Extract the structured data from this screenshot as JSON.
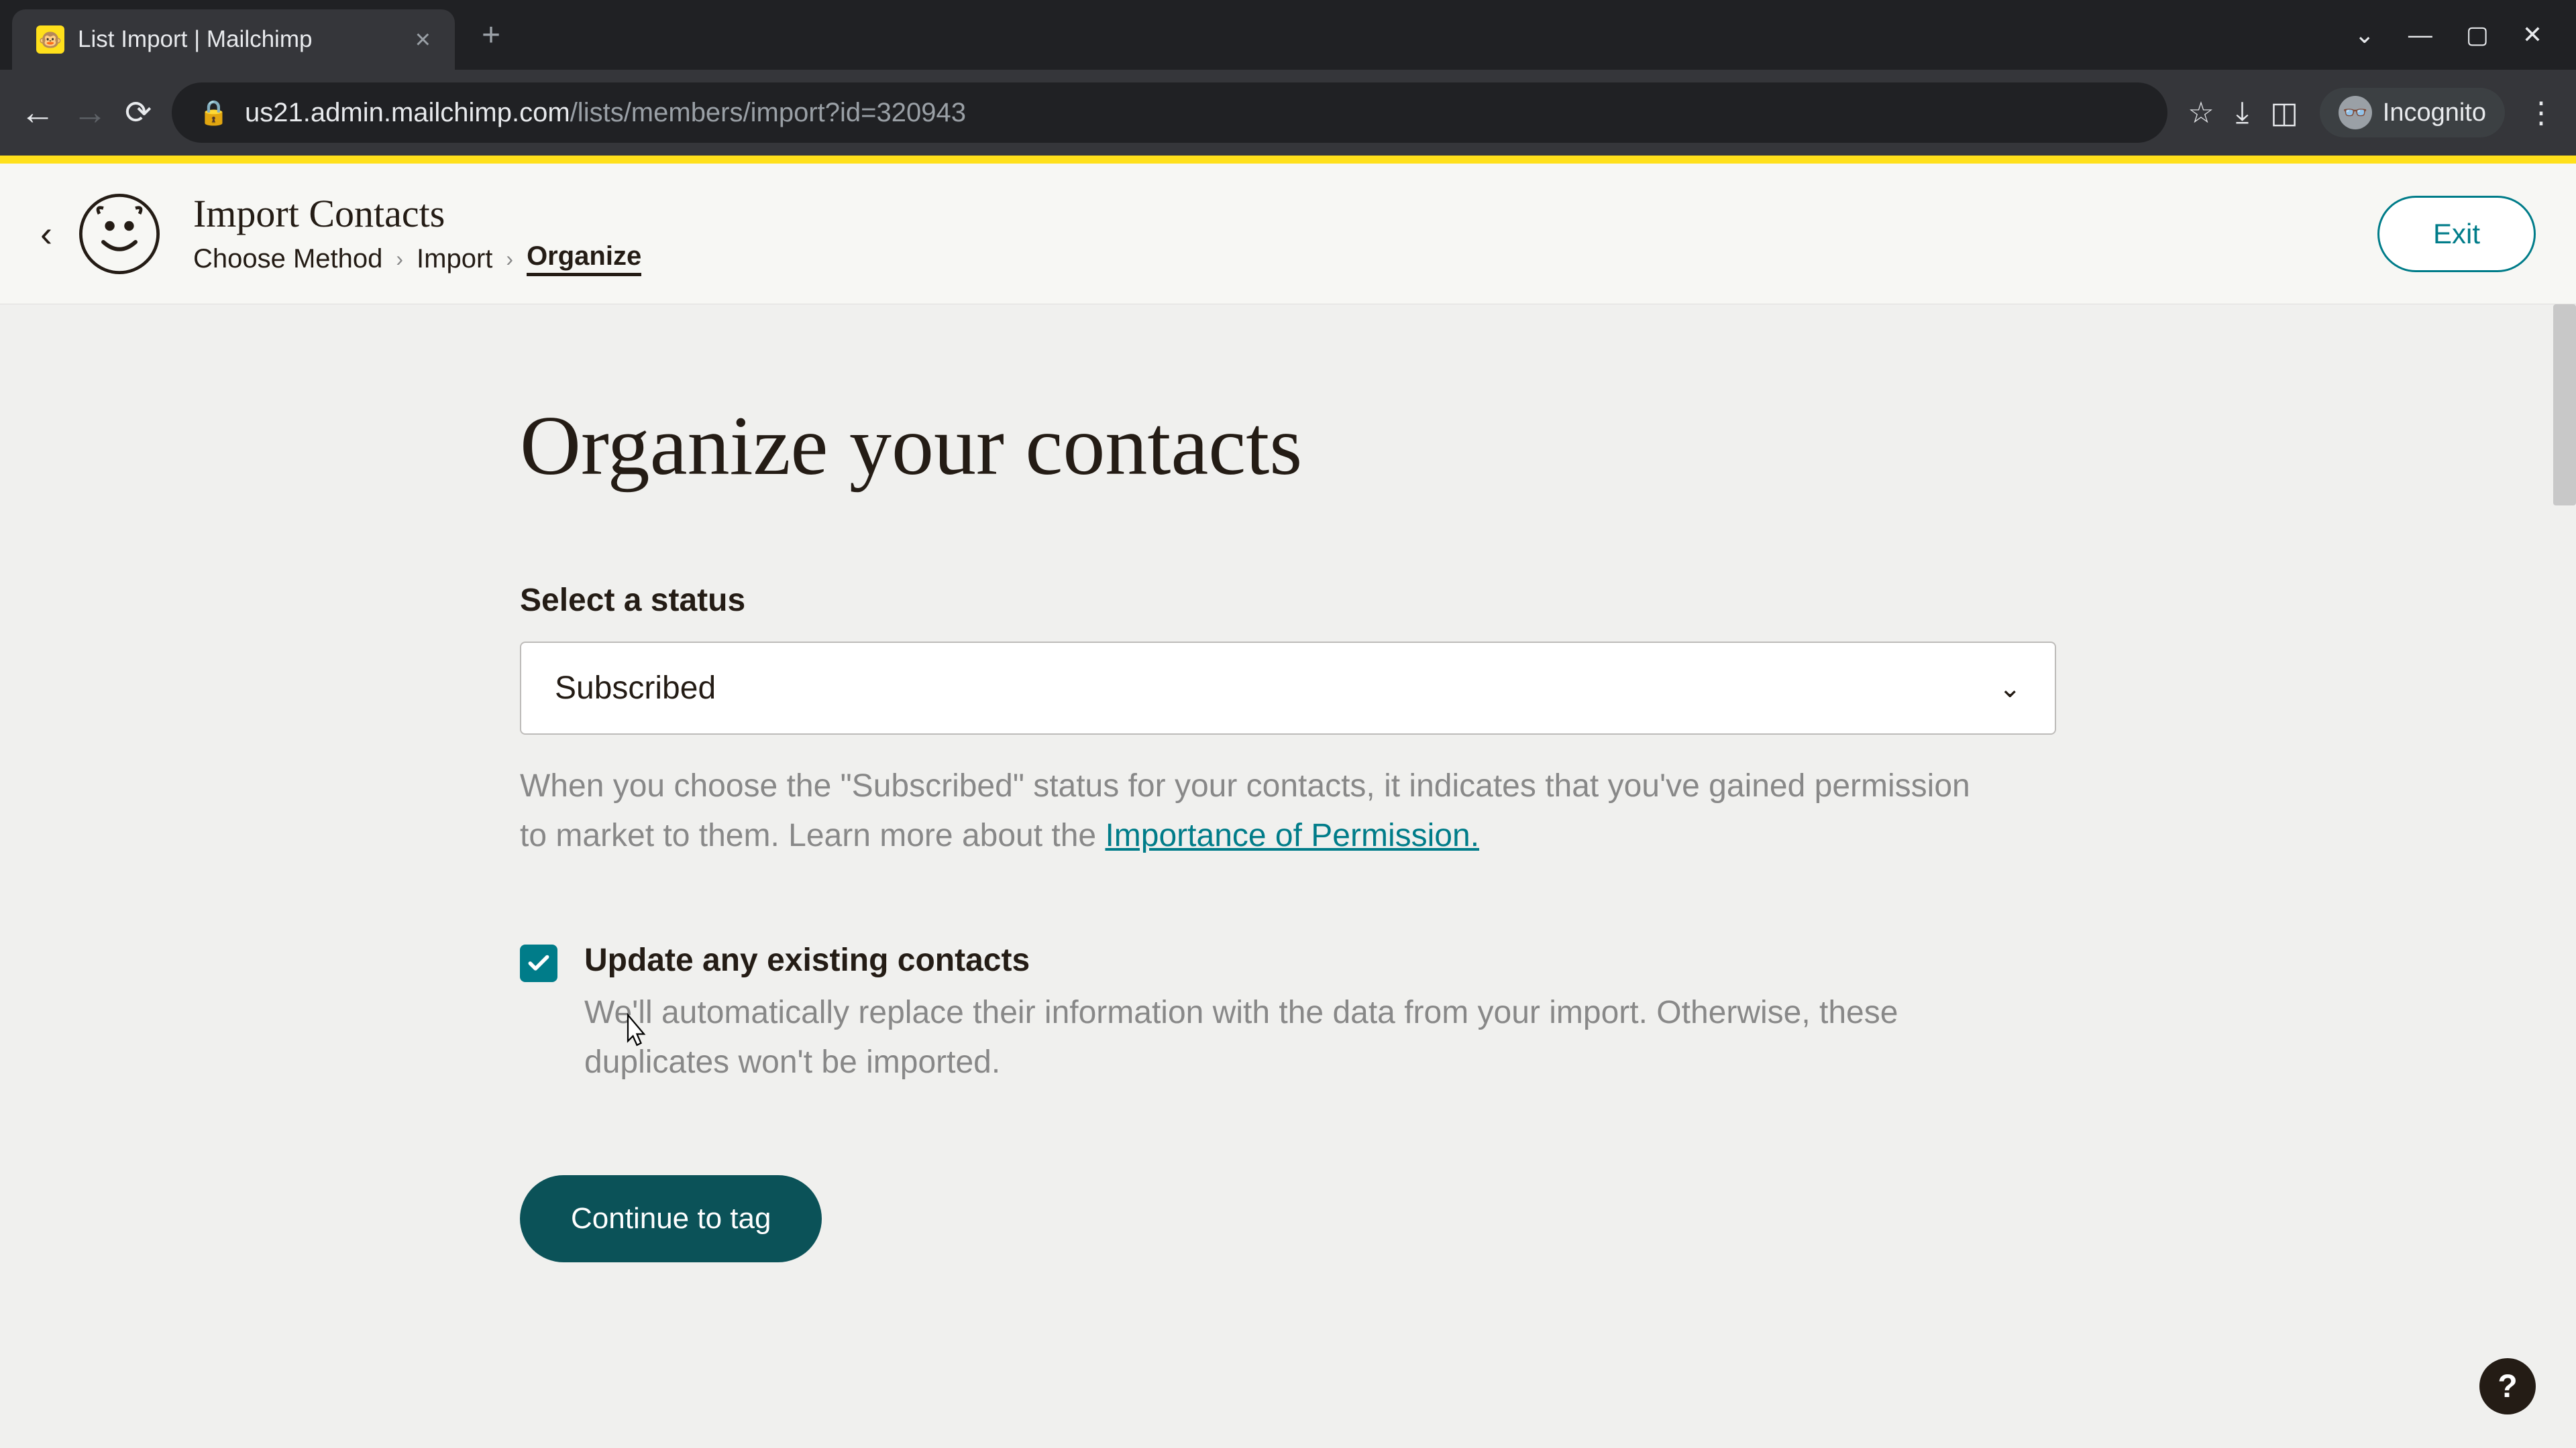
{
  "browser": {
    "tab_title": "List Import | Mailchimp",
    "url_host": "us21.admin.mailchimp.com",
    "url_path": "/lists/members/import?id=320943",
    "incognito_label": "Incognito"
  },
  "header": {
    "page_title": "Import Contacts",
    "breadcrumb": {
      "step1": "Choose Method",
      "step2": "Import",
      "step3": "Organize"
    },
    "exit_label": "Exit"
  },
  "main": {
    "heading": "Organize your contacts",
    "status": {
      "label": "Select a status",
      "selected": "Subscribed",
      "help_pre": "When you choose the \"Subscribed\" status for your contacts, it indicates that you've gained permission to market to them. Learn more about the ",
      "help_link": "Importance of Permission."
    },
    "update_checkbox": {
      "checked": true,
      "label": "Update any existing contacts",
      "description": "We'll automatically replace their information with the data from your import. Otherwise, these duplicates won't be imported."
    },
    "continue_label": "Continue to tag",
    "help_fab": "?"
  }
}
